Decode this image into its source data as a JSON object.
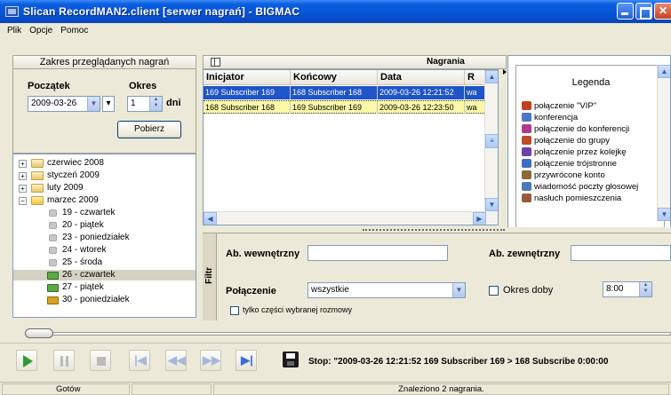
{
  "window": {
    "title": "Slican RecordMAN2.client [serwer nagrań] - BIGMAC"
  },
  "menu": [
    "Plik",
    "Opcje",
    "Pomoc"
  ],
  "range": {
    "header": "Zakres przeglądanych nagrań",
    "start_label": "Początek",
    "start_value": "2009-03-26",
    "period_label": "Okres",
    "period_value": "1",
    "period_unit": "dni",
    "fetch_button": "Pobierz"
  },
  "tree": [
    {
      "label": "czerwiec 2008",
      "type": "month",
      "expanded": false
    },
    {
      "label": "styczeń 2009",
      "type": "month",
      "expanded": false
    },
    {
      "label": "luty 2009",
      "type": "month",
      "expanded": false
    },
    {
      "label": "marzec 2009",
      "type": "month",
      "expanded": true
    },
    {
      "label": "19 - czwartek",
      "type": "day"
    },
    {
      "label": "20 - piątek",
      "type": "day"
    },
    {
      "label": "23 - poniedziałek",
      "type": "day"
    },
    {
      "label": "24 - wtorek",
      "type": "day"
    },
    {
      "label": "25 - środa",
      "type": "day"
    },
    {
      "label": "26 - czwartek",
      "type": "day-rec",
      "selected": true
    },
    {
      "label": "27 - piątek",
      "type": "day-rec"
    },
    {
      "label": "30 - poniedziałek",
      "type": "day-rec2"
    }
  ],
  "recordings": {
    "title": "Nagrania",
    "columns": [
      "Inicjator",
      "Końcowy",
      "Data",
      "R"
    ],
    "rows": [
      [
        "169 Subscriber 169",
        "168 Subscriber 168",
        "2009-03-26 12:21:52",
        "wa"
      ],
      [
        "168 Subscriber 168",
        "169 Subscriber 169",
        "2009-03-26 12:23:50",
        "wa"
      ]
    ]
  },
  "legend": {
    "title": "Legenda",
    "items": [
      {
        "label": "połączenie \"VIP\"",
        "color": "#c04020"
      },
      {
        "label": "konferencja",
        "color": "#4a78c8"
      },
      {
        "label": "połączenie do konferencji",
        "color": "#b03a8a"
      },
      {
        "label": "połączenie do grupy",
        "color": "#c04a2a"
      },
      {
        "label": "połączenie przez kolejkę",
        "color": "#7040a8"
      },
      {
        "label": "połączenie trójstronne",
        "color": "#3a6fc2"
      },
      {
        "label": "przywrócone konto",
        "color": "#8a6a3a"
      },
      {
        "label": "wiadomość poczty głosowej",
        "color": "#4a7ab8"
      },
      {
        "label": "nasłuch pomieszczenia",
        "color": "#9a5a3a"
      }
    ]
  },
  "filter": {
    "tab_label": "Filtr",
    "internal_label": "Ab. wewnętrzny",
    "internal_value": "",
    "external_label": "Ab. zewnętrzny",
    "external_value": "",
    "connection_label": "Połączenie",
    "connection_value": "wszystkie",
    "time_of_day_label": "Okres doby",
    "time_value": "8:00",
    "selected_only_label": "tylko części wybranej rozmowy"
  },
  "player": {
    "status_text": "Stop: \"2009-03-26 12:21:52  169 Subscriber 169 > 168 Subscribe  0:00:00"
  },
  "statusbar": {
    "left": "Gotów",
    "center": "Znaleziono 2 nagrania."
  }
}
